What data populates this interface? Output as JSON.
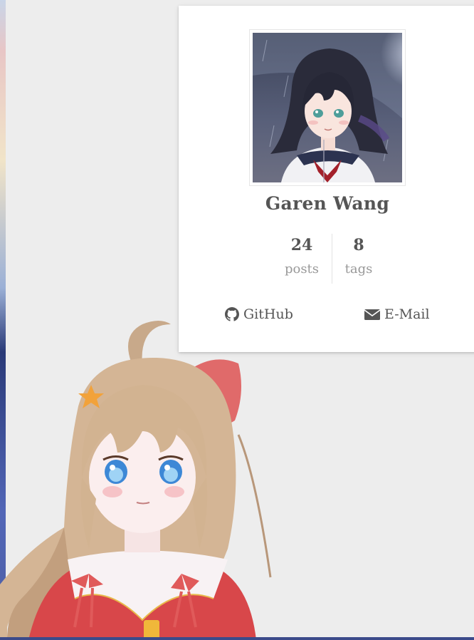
{
  "profile": {
    "name": "Garen Wang",
    "avatar_alt": "avatar",
    "stats": [
      {
        "count": "24",
        "label": "posts"
      },
      {
        "count": "8",
        "label": "tags"
      }
    ],
    "links": [
      {
        "label": "GitHub",
        "icon": "github-icon"
      },
      {
        "label": "E-Mail",
        "icon": "envelope-icon"
      }
    ]
  },
  "colors": {
    "background": "#ededed",
    "card": "#ffffff",
    "name_text": "#555555",
    "muted_text": "#999999"
  }
}
